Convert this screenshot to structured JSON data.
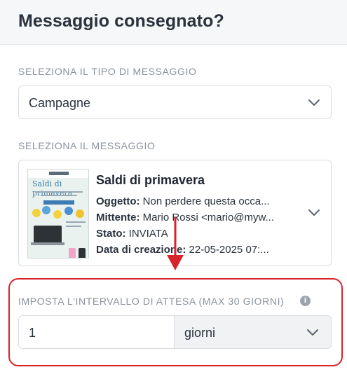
{
  "header": {
    "title": "Messaggio consegnato?"
  },
  "message_type": {
    "label": "SELEZIONA IL TIPO DI MESSAGGIO",
    "selected": "Campagne"
  },
  "message": {
    "label": "SELEZIONA IL MESSAGGIO",
    "thumbnail_title": "Saldi di primavera",
    "title": "Saldi di primavera",
    "subject_label": "Oggetto:",
    "subject_value": "Non perdere questa occa...",
    "sender_label": "Mittente:",
    "sender_value": "Mario Rossi <mario@myw...",
    "status_label": "Stato:",
    "status_value": "INVIATA",
    "created_label": "Data di creazione:",
    "created_value": "22-05-2025 07:..."
  },
  "interval": {
    "label": "IMPOSTA L'INTERVALLO DI ATTESA (MAX 30 GIORNI)",
    "info_icon": "i",
    "value": "1",
    "unit": "giorni"
  },
  "colors": {
    "highlight": "#d9232a",
    "label_gray": "#8a929d"
  },
  "icons": [
    "chevron-down-icon",
    "info-icon",
    "arrow-down-icon"
  ]
}
